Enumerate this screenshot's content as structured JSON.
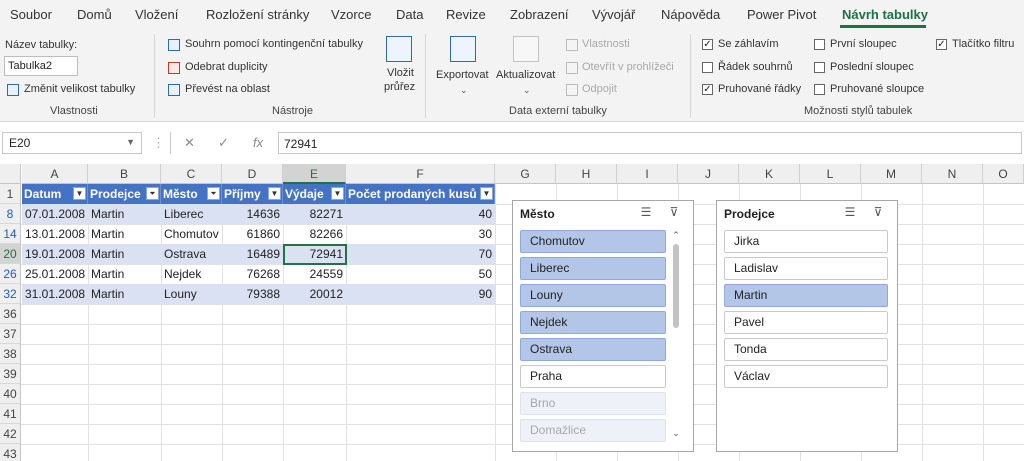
{
  "menu": {
    "tabs": [
      "Soubor",
      "Domů",
      "Vložení",
      "Rozložení stránky",
      "Vzorce",
      "Data",
      "Revize",
      "Zobrazení",
      "Vývojář",
      "Nápověda",
      "Power Pivot",
      "Návrh tabulky"
    ],
    "active": "Návrh tabulky"
  },
  "ribbon": {
    "properties": {
      "name_label": "Název tabulky:",
      "name_value": "Tabulka2",
      "resize": "Změnit velikost tabulky",
      "group": "Vlastnosti"
    },
    "tools": {
      "pivot": "Souhrn pomocí kontingenční tabulky",
      "remove_dupes": "Odebrat duplicity",
      "convert": "Převést na oblast",
      "slicer_line1": "Vložit",
      "slicer_line2": "průřez",
      "group": "Nástroje"
    },
    "external": {
      "export": "Exportovat",
      "refresh": "Aktualizovat",
      "properties": "Vlastnosti",
      "open_browser": "Otevřít v prohlížeči",
      "unlink": "Odpojit",
      "group": "Data externí tabulky"
    },
    "style_options": {
      "header_row": {
        "label": "Se záhlavím",
        "checked": true
      },
      "total_row": {
        "label": "Řádek souhrnů",
        "checked": false
      },
      "banded_rows": {
        "label": "Pruhované řádky",
        "checked": true
      },
      "first_column": {
        "label": "První sloupec",
        "checked": false
      },
      "last_column": {
        "label": "Poslední sloupec",
        "checked": false
      },
      "banded_columns": {
        "label": "Pruhované sloupce",
        "checked": false
      },
      "filter_button": {
        "label": "Tlačítko filtru",
        "checked": true
      },
      "group": "Možnosti stylů tabulek"
    }
  },
  "formula_bar": {
    "cell_ref": "E20",
    "cancel_glyph": "✕",
    "enter_glyph": "✓",
    "fx_glyph": "fx",
    "value": "72941"
  },
  "sheet": {
    "columns": [
      "A",
      "B",
      "C",
      "D",
      "E",
      "F",
      "G",
      "H",
      "I",
      "J",
      "K",
      "L",
      "M",
      "N",
      "O"
    ],
    "selected_column": "E",
    "rows": [
      "1",
      "8",
      "14",
      "20",
      "26",
      "32",
      "36",
      "37",
      "38",
      "39",
      "40",
      "41",
      "42",
      "43"
    ],
    "filtered_rows": [
      "8",
      "14",
      "20",
      "26",
      "32"
    ],
    "selected_row": "20",
    "table_headers": [
      "Datum",
      "Prodejce",
      "Město",
      "Příjmy",
      "Výdaje",
      "Počet prodaných kusů"
    ],
    "header_filter_icons": [
      "▼",
      "⏷",
      "⏷",
      "▼",
      "▼",
      "▼"
    ],
    "table_rows": [
      [
        "07.01.2008",
        "Martin",
        "Liberec",
        "14636",
        "82271",
        "40"
      ],
      [
        "13.01.2008",
        "Martin",
        "Chomutov",
        "61860",
        "82266",
        "30"
      ],
      [
        "19.01.2008",
        "Martin",
        "Ostrava",
        "16489",
        "72941",
        "70"
      ],
      [
        "25.01.2008",
        "Martin",
        "Nejdek",
        "76268",
        "24559",
        "50"
      ],
      [
        "31.01.2008",
        "Martin",
        "Louny",
        "79388",
        "20012",
        "90"
      ]
    ]
  },
  "slicers": [
    {
      "title": "Město",
      "items": [
        {
          "label": "Chomutov",
          "state": "selected"
        },
        {
          "label": "Liberec",
          "state": "selected"
        },
        {
          "label": "Louny",
          "state": "selected"
        },
        {
          "label": "Nejdek",
          "state": "selected"
        },
        {
          "label": "Ostrava",
          "state": "selected"
        },
        {
          "label": "Praha",
          "state": "normal"
        },
        {
          "label": "Brno",
          "state": "nodata"
        },
        {
          "label": "Domažlice",
          "state": "nodata"
        }
      ]
    },
    {
      "title": "Prodejce",
      "items": [
        {
          "label": "Jirka",
          "state": "normal"
        },
        {
          "label": "Ladislav",
          "state": "normal"
        },
        {
          "label": "Martin",
          "state": "selected"
        },
        {
          "label": "Pavel",
          "state": "normal"
        },
        {
          "label": "Tonda",
          "state": "normal"
        },
        {
          "label": "Václav",
          "state": "normal"
        }
      ]
    }
  ],
  "icons": {
    "multiselect": "multi-select-icon",
    "clear_filter": "clear-filter-icon"
  }
}
